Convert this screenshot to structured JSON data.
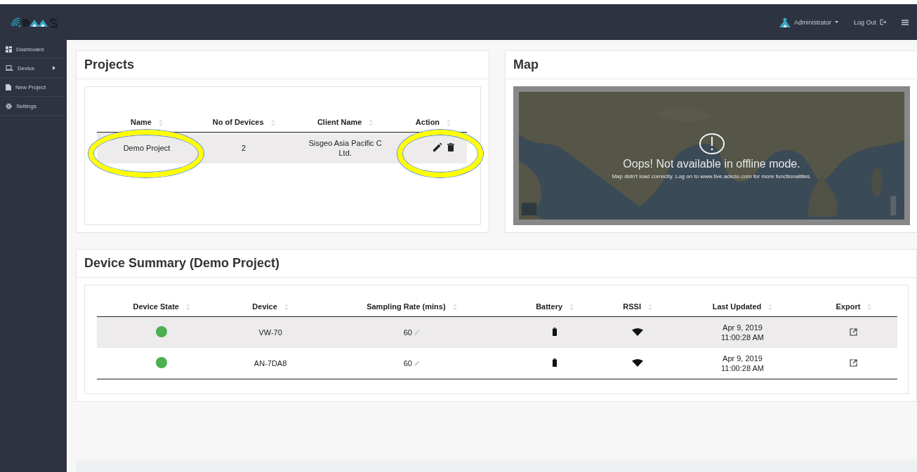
{
  "topbar": {
    "user": "Administrator",
    "logout": "Log Out"
  },
  "sidebar": {
    "items": [
      {
        "label": "Dashboard",
        "kind": "dashboard",
        "has_children": false
      },
      {
        "label": "Device",
        "kind": "device",
        "has_children": true
      },
      {
        "label": "New Project",
        "kind": "file",
        "has_children": false
      },
      {
        "label": "Settings",
        "kind": "gear",
        "has_children": false
      }
    ]
  },
  "projects": {
    "title": "Projects",
    "columns": [
      "Name",
      "No of Devices",
      "Client Name",
      "Action"
    ],
    "rows": [
      {
        "name": "Demo Project",
        "devices": "2",
        "client": "Sisgeo Asia Pacific C",
        "client_line_2": "Ltd.",
        "highlighted": true
      }
    ]
  },
  "map": {
    "title": "Map",
    "message": "Oops! Not available in offline mode.",
    "detail": "Map didn't load correctly.  Log on to www.live.ackcio.com for more functionalities."
  },
  "summary": {
    "title": "Device Summary (Demo Project)",
    "columns": [
      "Device State",
      "Device",
      "Sampling Rate (mins)",
      "Battery",
      "RSSI",
      "Last Updated",
      "Export"
    ],
    "rows": [
      {
        "color": "#4caf50",
        "device": "VW-70",
        "rate": "60",
        "date": "Apr 9, 2019",
        "time": "11:00:28 AM",
        "shaded": true
      },
      {
        "color": "#4caf50",
        "device": "AN-7DA8",
        "rate": "60",
        "date": "Apr 9, 2019",
        "time": "11:00:28 AM",
        "shaded": false
      }
    ]
  }
}
